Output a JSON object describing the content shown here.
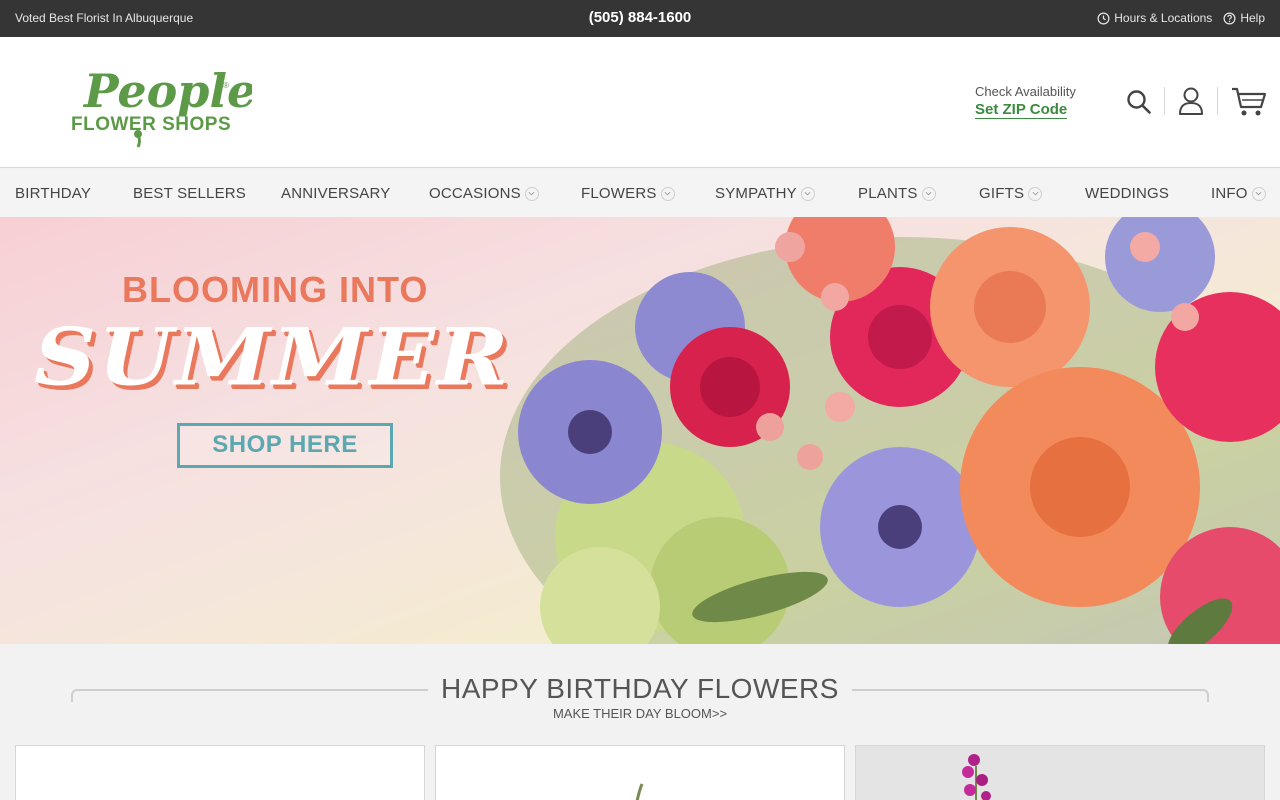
{
  "topbar": {
    "tagline": "Voted Best Florist In Albuquerque",
    "phone": "(505) 884-1600",
    "hours_label": "Hours & Locations",
    "help_label": "Help"
  },
  "header": {
    "logo_text_top": "Peoples",
    "logo_text_bottom": "FLOWER SHOPS",
    "logo_mark": "®",
    "availability_label": "Check Availability",
    "zip_link": "Set ZIP Code",
    "icons": [
      "search-icon",
      "account-icon",
      "cart-icon"
    ]
  },
  "nav": {
    "items": [
      {
        "label": "BIRTHDAY",
        "dropdown": false
      },
      {
        "label": "BEST SELLERS",
        "dropdown": false
      },
      {
        "label": "ANNIVERSARY",
        "dropdown": false
      },
      {
        "label": "OCCASIONS",
        "dropdown": true
      },
      {
        "label": "FLOWERS",
        "dropdown": true
      },
      {
        "label": "SYMPATHY",
        "dropdown": true
      },
      {
        "label": "PLANTS",
        "dropdown": true
      },
      {
        "label": "GIFTS",
        "dropdown": true
      },
      {
        "label": "WEDDINGS",
        "dropdown": false
      },
      {
        "label": "INFO",
        "dropdown": true
      }
    ]
  },
  "hero": {
    "pre_title": "BLOOMING INTO",
    "title": "SUMMER",
    "cta": "SHOP HERE"
  },
  "section": {
    "title": "HAPPY BIRTHDAY FLOWERS",
    "subtitle": "MAKE THEIR DAY BLOOM>>"
  },
  "colors": {
    "topbar_bg": "#353535",
    "brand_green": "#3b8a3e",
    "accent_coral": "#e9785c",
    "cta_teal": "#5ba8b1"
  }
}
